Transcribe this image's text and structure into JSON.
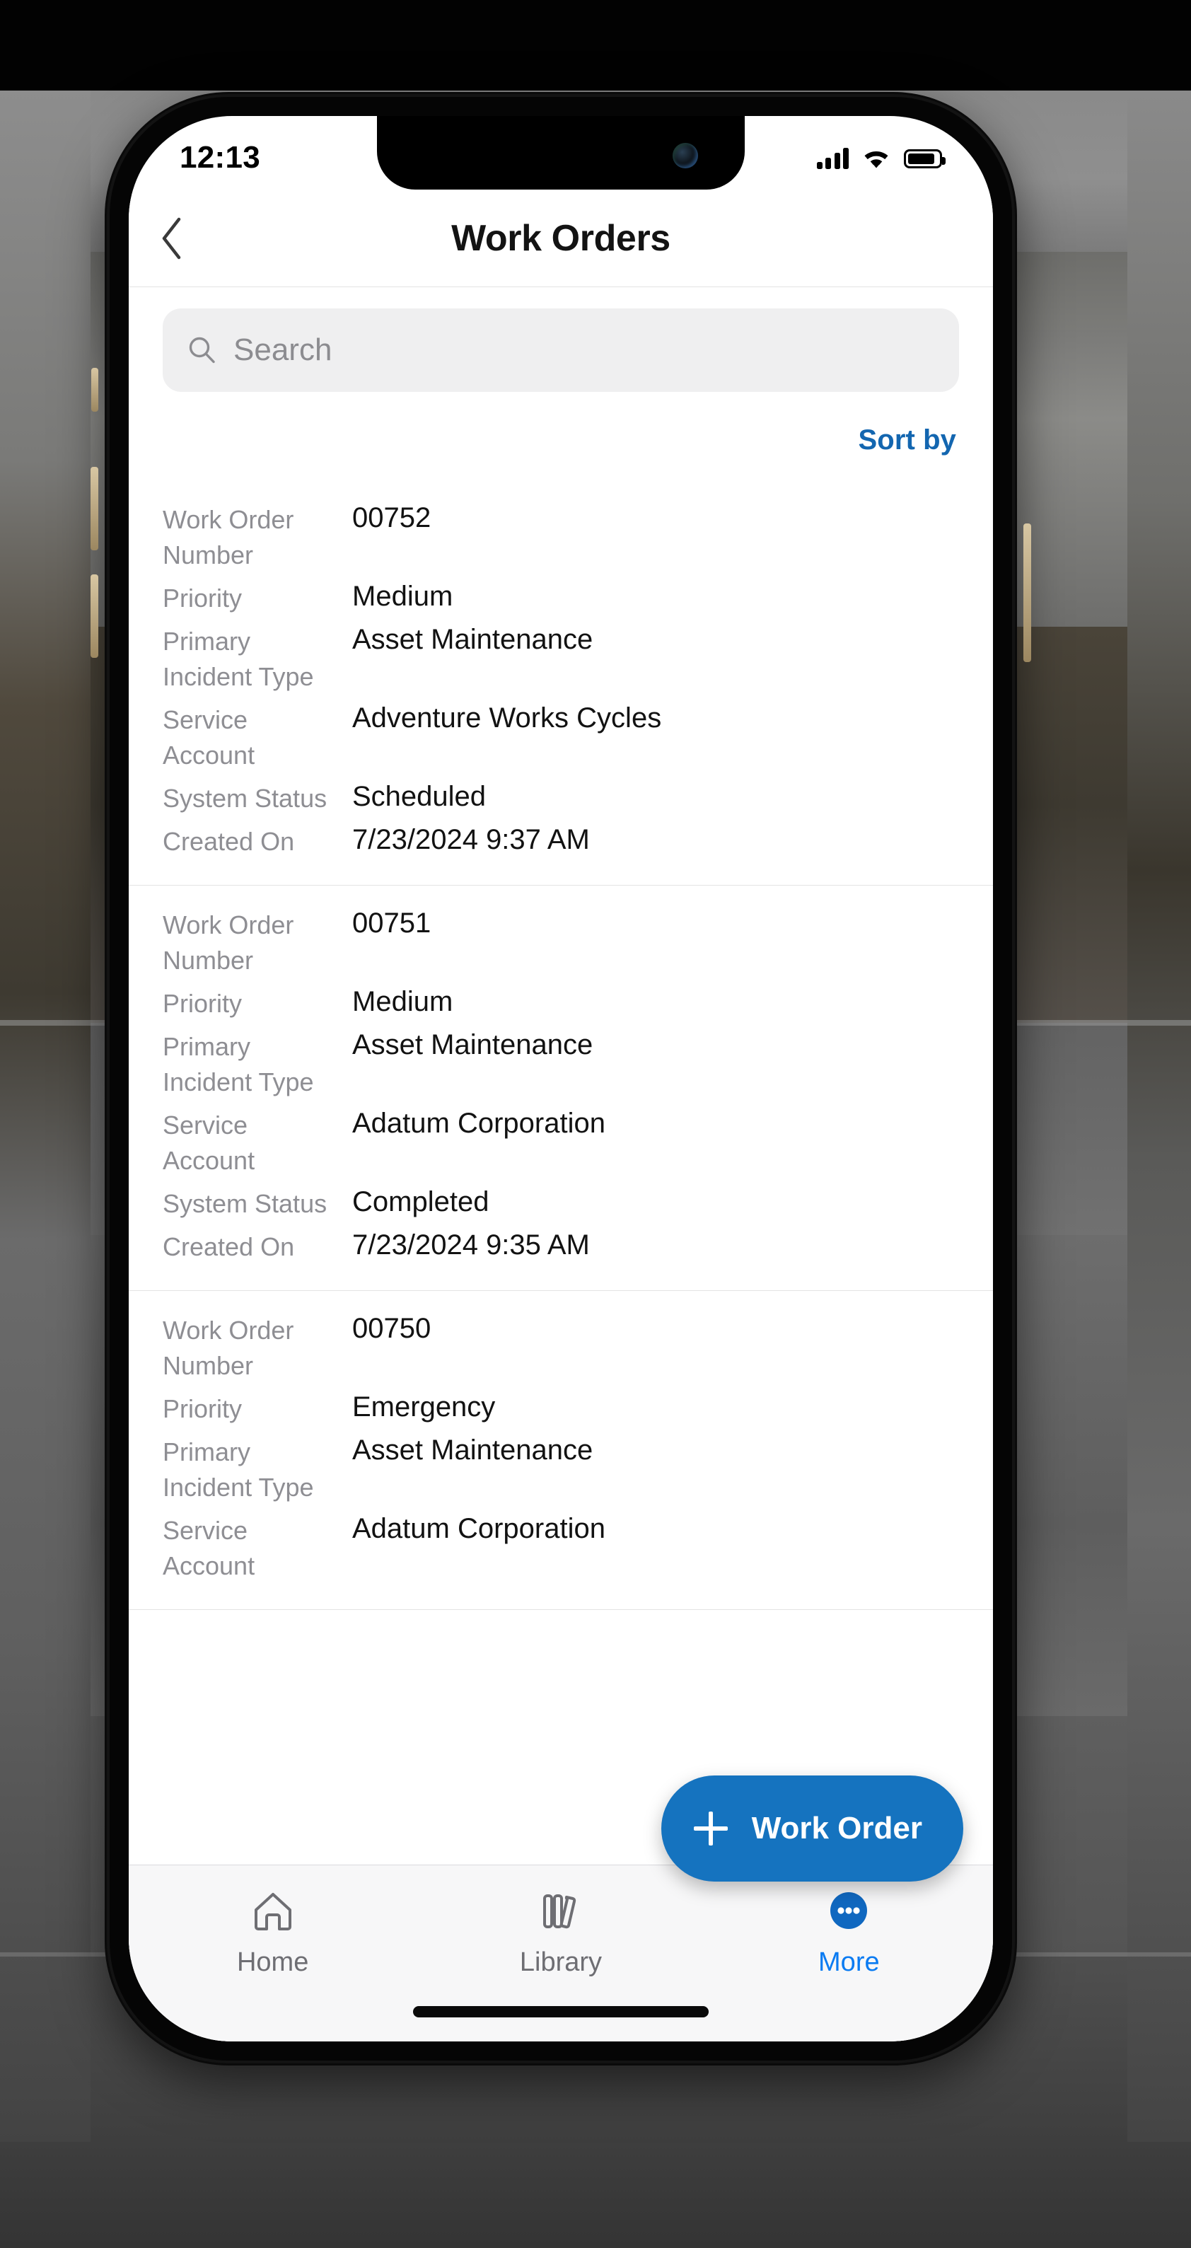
{
  "status_bar": {
    "time": "12:13",
    "cellular_icon": "cellular-signal-icon",
    "wifi_icon": "wifi-icon",
    "battery_icon": "battery-icon"
  },
  "navbar": {
    "back_icon": "chevron-left-icon",
    "title": "Work Orders"
  },
  "search": {
    "icon": "search-icon",
    "placeholder": "Search",
    "value": ""
  },
  "toolbar": {
    "sort_label": "Sort by"
  },
  "field_labels": {
    "work_order_number": "Work Order Number",
    "priority": "Priority",
    "primary_incident_type": "Primary Incident Type",
    "service_account": "Service Account",
    "system_status": "System Status",
    "created_on": "Created On"
  },
  "work_orders": [
    {
      "work_order_number": "00752",
      "priority": "Medium",
      "primary_incident_type": "Asset Maintenance",
      "service_account": "Adventure Works Cycles",
      "system_status": "Scheduled",
      "created_on": "7/23/2024 9:37 AM"
    },
    {
      "work_order_number": "00751",
      "priority": "Medium",
      "primary_incident_type": "Asset Maintenance",
      "service_account": "Adatum Corporation",
      "system_status": "Completed",
      "created_on": "7/23/2024 9:35 AM"
    },
    {
      "work_order_number": "00750",
      "priority": "Emergency",
      "primary_incident_type": "Asset Maintenance",
      "service_account": "Adatum Corporation",
      "system_status": "",
      "created_on": ""
    }
  ],
  "fab": {
    "icon": "plus-icon",
    "label": "Work Order"
  },
  "tabbar": {
    "items": [
      {
        "label": "Home",
        "icon": "home-icon",
        "active": false
      },
      {
        "label": "Library",
        "icon": "library-icon",
        "active": false
      },
      {
        "label": "More",
        "icon": "more-dots-icon",
        "active": true
      }
    ]
  },
  "colors": {
    "accent_blue": "#1366b0",
    "fab_blue": "#1573bf",
    "tab_active_blue": "#0a7bf2",
    "label_gray": "#8e8e93",
    "value_black": "#121212"
  }
}
